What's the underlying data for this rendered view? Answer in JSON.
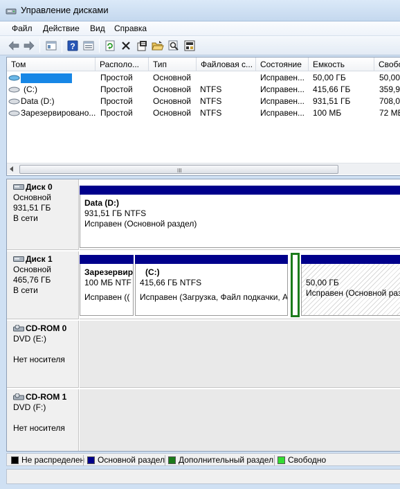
{
  "window": {
    "title": "Управление дисками"
  },
  "menu": [
    "Файл",
    "Действие",
    "Вид",
    "Справка"
  ],
  "toolbar": [
    "back-icon",
    "forward-icon",
    "console-tree-icon",
    "help-icon",
    "properties-icon",
    "refresh-icon",
    "delete-icon",
    "settings-icon",
    "open-folder-icon",
    "find-icon",
    "disk-properties-icon"
  ],
  "volumes": {
    "columns": [
      "Том",
      "Располо...",
      "Тип",
      "Файловая с...",
      "Состояние",
      "Емкость",
      "Свобо"
    ],
    "rows": [
      {
        "name": "",
        "layout": "Простой",
        "type": "Основной",
        "fs": "",
        "status": "Исправен...",
        "capacity": "50,00 ГБ",
        "free": "50,00"
      },
      {
        "name": "(C:)",
        "layout": "Простой",
        "type": "Основной",
        "fs": "NTFS",
        "status": "Исправен...",
        "capacity": "415,66 ГБ",
        "free": "359,91"
      },
      {
        "name": "Data (D:)",
        "layout": "Простой",
        "type": "Основной",
        "fs": "NTFS",
        "status": "Исправен...",
        "capacity": "931,51 ГБ",
        "free": "708,05"
      },
      {
        "name": "Зарезервировано...",
        "layout": "Простой",
        "type": "Основной",
        "fs": "NTFS",
        "status": "Исправен...",
        "capacity": "100 МБ",
        "free": "72 МБ"
      }
    ],
    "scroll_grip": "III"
  },
  "disks": {
    "disk0": {
      "name": "Диск 0",
      "kind": "Основной",
      "size": "931,51 ГБ",
      "state": "В сети",
      "partitions": [
        {
          "name": "Data  (D:)",
          "size": "931,51 ГБ NTFS",
          "status": "Исправен (Основной раздел)"
        }
      ]
    },
    "disk1": {
      "name": "Диск 1",
      "kind": "Основной",
      "size": "465,76 ГБ",
      "state": "В сети",
      "partitions": [
        {
          "name": "Зарезервир",
          "size": "100 МБ NTF",
          "status": "Исправен (("
        },
        {
          "name": "(C:)",
          "size": "415,66 ГБ NTFS",
          "status": "Исправен (Загрузка, Файл подкачки, А"
        },
        {
          "name": "",
          "size": "50,00 ГБ",
          "status": "Исправен (Основной разд"
        }
      ]
    },
    "cdrom0": {
      "name": "CD-ROM 0",
      "kind": "DVD (E:)",
      "state": "Нет носителя"
    },
    "cdrom1": {
      "name": "CD-ROM 1",
      "kind": "DVD (F:)",
      "state": "Нет носителя"
    }
  },
  "legend": {
    "items": [
      {
        "label": "Не распределен",
        "color": "#000000"
      },
      {
        "label": "Основной раздел",
        "color": "#00008b"
      },
      {
        "label": "Дополнительный раздел",
        "color": "#1b7b1b"
      },
      {
        "label": "Свободно",
        "color": "#33dd33"
      }
    ]
  },
  "colors": {
    "primary_partition": "#00008b",
    "selection": "#1b7b1b",
    "redaction": "#1787e6"
  }
}
